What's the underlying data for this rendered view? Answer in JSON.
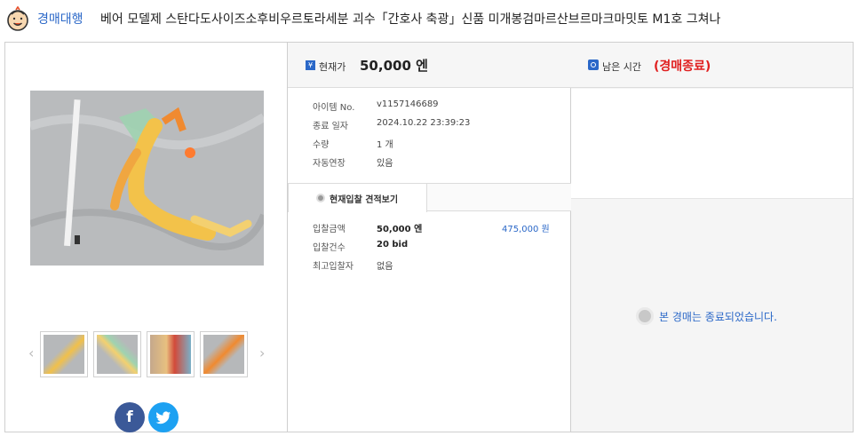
{
  "header": {
    "logo_icon": "smiling-face-logo-icon",
    "proxy_link": "경매대행",
    "item_title": "베어 모델제 스탄다도사이즈소후비우르토라세분 괴수「간호사 축광」신품 미개봉검마르산브르마크마밋토 M1호 그쳐나"
  },
  "gallery": {
    "main_image": "main-product-photo",
    "thumbnails": [
      "thumbnail-1",
      "thumbnail-2",
      "thumbnail-3",
      "thumbnail-4"
    ],
    "prev_arrow": "‹",
    "next_arrow": "›",
    "share": {
      "facebook_label": "f",
      "twitter_icon": "twitter-bird-icon"
    }
  },
  "price": {
    "icon": "¥",
    "label": "현재가",
    "value": "50,000 엔"
  },
  "info": [
    {
      "label": "아이템 No.",
      "value": "v1157146689"
    },
    {
      "label": "종료 일자",
      "value": "2024.10.22 23:39:23"
    },
    {
      "label": "수량",
      "value": "1 개"
    },
    {
      "label": "자동연장",
      "value": "있음"
    }
  ],
  "bid_tab": {
    "label": "현재입찰 견적보기"
  },
  "bid": [
    {
      "label": "입찰금액",
      "value": "50,000 엔",
      "won": "475,000 원"
    },
    {
      "label": "입찰건수",
      "value": "20 bid",
      "won": ""
    },
    {
      "label": "최고입찰자",
      "value": "없음",
      "won": ""
    }
  ],
  "time": {
    "label": "남은 시간",
    "status": "(경매종료)",
    "ended_message": "본 경매는 종료되었습니다."
  },
  "colors": {
    "accent": "#2b68c8",
    "status_red": "#e02020",
    "facebook": "#3b5998",
    "twitter": "#1da1f2"
  }
}
